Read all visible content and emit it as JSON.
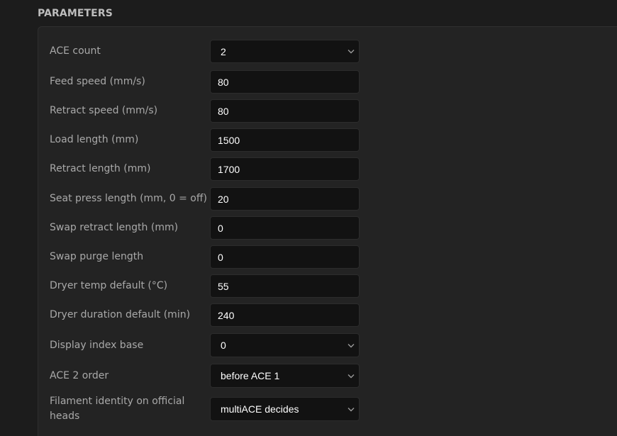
{
  "section": {
    "title": "PARAMETERS"
  },
  "fields": [
    {
      "label": "ACE count",
      "type": "select",
      "value": "2"
    },
    {
      "label": "Feed speed (mm/s)",
      "type": "input",
      "value": "80"
    },
    {
      "label": "Retract speed (mm/s)",
      "type": "input",
      "value": "80"
    },
    {
      "label": "Load length (mm)",
      "type": "input",
      "value": "1500"
    },
    {
      "label": "Retract length (mm)",
      "type": "input",
      "value": "1700"
    },
    {
      "label": "Seat press length (mm, 0 = off)",
      "type": "input",
      "value": "20"
    },
    {
      "label": "Swap retract length (mm)",
      "type": "input",
      "value": "0"
    },
    {
      "label": "Swap purge length",
      "type": "input",
      "value": "0"
    },
    {
      "label": "Dryer temp default (°C)",
      "type": "input",
      "value": "55"
    },
    {
      "label": "Dryer duration default (min)",
      "type": "input",
      "value": "240"
    },
    {
      "label": "Display index base",
      "type": "select",
      "value": "0"
    },
    {
      "label": "ACE 2 order",
      "type": "select",
      "value": "before ACE 1"
    },
    {
      "label": "Filament identity on official heads",
      "type": "select",
      "value": "multiACE decides"
    }
  ],
  "icons": {
    "select_arrow": "chevron-down-icon"
  },
  "colors": {
    "background": "#1c1c1c",
    "panel": "#232323",
    "input_background": "#121212",
    "label_text": "#a9a9a9",
    "value_text": "#ffffff"
  }
}
